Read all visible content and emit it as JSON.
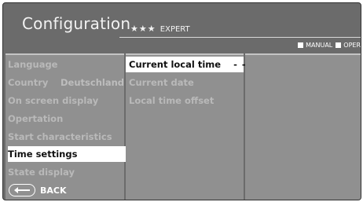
{
  "header": {
    "title": "Configuration",
    "level_stars": "★★★",
    "level_label": "EXPERT"
  },
  "modebar": {
    "manual_label": "MANUAL",
    "oper_label": "OPER"
  },
  "main_menu": {
    "items": [
      {
        "label": "Language",
        "value": ""
      },
      {
        "label": "Country",
        "value": "Deutschland"
      },
      {
        "label": "On screen display",
        "value": ""
      },
      {
        "label": "Opertation",
        "value": ""
      },
      {
        "label": "Start characteristics",
        "value": ""
      },
      {
        "label": "Time settings",
        "value": ""
      },
      {
        "label": "State display",
        "value": ""
      }
    ],
    "selected_index": 5
  },
  "sub_menu": {
    "items": [
      {
        "label": "Current local time",
        "value": "- -:- -"
      },
      {
        "label": "Current date",
        "value": ""
      },
      {
        "label": "Local time offset",
        "value": ""
      }
    ],
    "selected_index": 0
  },
  "back": {
    "label": "BACK",
    "icon": "back-arrow-icon"
  }
}
